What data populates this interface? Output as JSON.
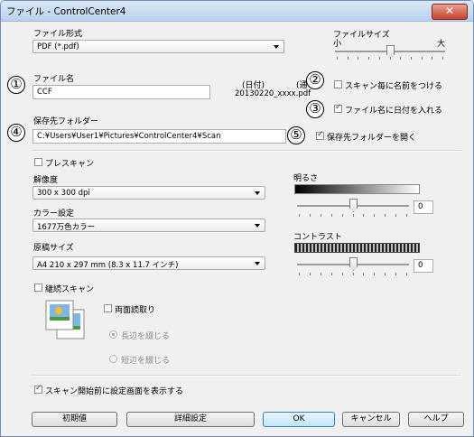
{
  "window": {
    "title": "ファイル - ControlCenter4",
    "close_symbol": "✕"
  },
  "file_format": {
    "label": "ファイル形式",
    "value": "PDF (*.pdf)"
  },
  "file_size": {
    "label": "ファイルサイズ",
    "small": "小",
    "large": "大",
    "level": 0.5
  },
  "file_name": {
    "label": "ファイル名",
    "value": "CCF"
  },
  "date_preview": {
    "date_label": "(日付)",
    "serial_label": "(通",
    "sample": "20130220_xxxx.pdf"
  },
  "options": {
    "name_each_scan": {
      "label": "スキャン毎に名前をつける",
      "checked": false
    },
    "insert_date": {
      "label": "ファイル名に日付を入れる",
      "checked": true
    },
    "open_folder": {
      "label": "保存先フォルダーを開く",
      "checked": true
    }
  },
  "destination": {
    "label": "保存先フォルダー",
    "value": "C:¥Users¥User1¥Pictures¥ControlCenter4¥Scan"
  },
  "prescan": {
    "label": "プレスキャン",
    "checked": false
  },
  "resolution": {
    "label": "解像度",
    "value": "300 x 300 dpi"
  },
  "color_setting": {
    "label": "カラー設定",
    "value": "1677万色カラー"
  },
  "document_size": {
    "label": "原稿サイズ",
    "value": "A4 210 x 297 mm (8.3 x 11.7 インチ)"
  },
  "brightness": {
    "label": "明るさ",
    "value": "0",
    "level": 0.5
  },
  "contrast": {
    "label": "コントラスト",
    "value": "0",
    "level": 0.5
  },
  "continuous_scan": {
    "label": "継続スキャン",
    "checked": false
  },
  "duplex": {
    "label": "両面読取り",
    "checked": false,
    "long_edge": "長辺を綴じる",
    "short_edge": "短辺を綴じる"
  },
  "show_settings": {
    "label": "スキャン開始前に設定画面を表示する",
    "checked": true
  },
  "buttons": {
    "default": "初期値",
    "advanced": "詳細設定",
    "ok": "OK",
    "cancel": "キャンセル",
    "help": "ヘルプ"
  },
  "callouts": [
    "①",
    "②",
    "③",
    "④",
    "⑤"
  ],
  "check_glyph": "✓",
  "colors": {
    "title_bg": "#c4d8f1",
    "close_btn": "#c6412c",
    "default_button": "#bee6fd"
  }
}
